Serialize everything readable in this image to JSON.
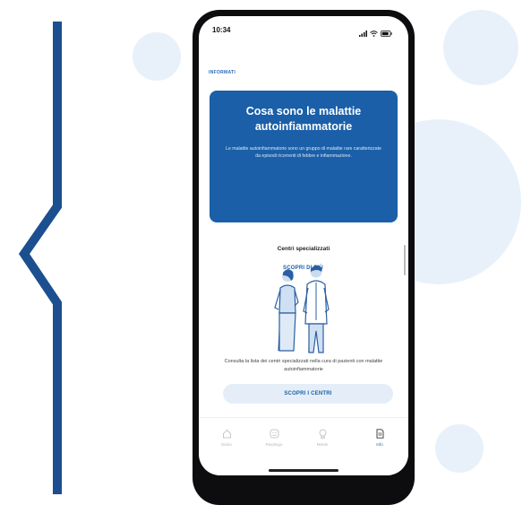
{
  "status_bar": {
    "time": "10:34"
  },
  "section_label": "INFORMATI",
  "info_card": {
    "title": "Cosa sono le malattie autoinfiammatorie",
    "description": "Le malattie autoinfiammatorie sono un gruppo di malattie rare caratterizzate da episodi ricorrenti di febbre e infiammazione.",
    "button_label": "SCOPRI DI PIÙ"
  },
  "centers": {
    "title": "Centri specializzati",
    "description": "Consulta la lista dei centri specializzati nella cura di pazienti con malattie autoinfiammatorie",
    "button_label": "SCOPRI I CENTRI"
  },
  "tab_bar": {
    "items": [
      {
        "label": "Diario",
        "icon": "home-icon"
      },
      {
        "label": "Riepilogo",
        "icon": "smiley-icon"
      },
      {
        "label": "Mente",
        "icon": "brain-icon"
      },
      {
        "label": "Info",
        "icon": "document-icon",
        "active": true
      }
    ]
  },
  "colors": {
    "accent": "#1a5fa8",
    "decor_line": "#1c4f8f",
    "bubble": "#e8f1fa"
  }
}
